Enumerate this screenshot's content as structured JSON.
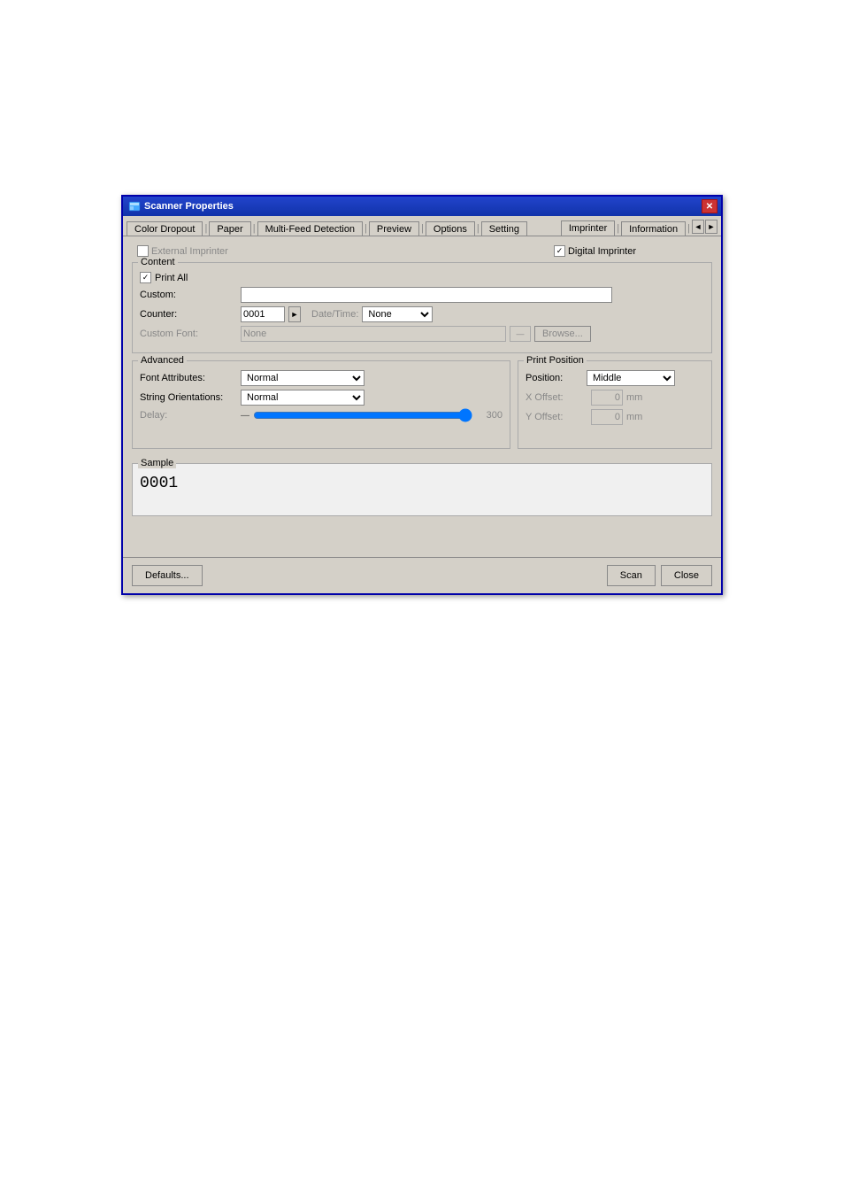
{
  "window": {
    "title": "Scanner Properties",
    "close_label": "✕"
  },
  "tabs": [
    {
      "label": "Color Dropout",
      "active": false
    },
    {
      "label": "Paper",
      "active": false
    },
    {
      "label": "Multi-Feed Detection",
      "active": false
    },
    {
      "label": "Preview",
      "active": false
    },
    {
      "label": "Options",
      "active": false
    },
    {
      "label": "Setting",
      "active": false
    },
    {
      "label": "Imprinter",
      "active": true
    },
    {
      "label": "Information",
      "active": false
    }
  ],
  "nav_arrows": {
    "left": "◄",
    "right": "►"
  },
  "imprinter": {
    "external_label": "External Imprinter",
    "external_checked": false,
    "digital_label": "Digital Imprinter",
    "digital_checked": true
  },
  "content_section": {
    "title": "Content",
    "print_all_label": "Print All",
    "print_all_checked": true,
    "custom_label": "Custom:",
    "custom_value": "",
    "counter_label": "Counter:",
    "counter_value": "0001",
    "counter_arrow": "►",
    "datetime_label": "Date/Time:",
    "datetime_value": "None",
    "datetime_options": [
      "None"
    ],
    "custom_font_label": "Custom Font:",
    "custom_font_value": "None",
    "font_btn_label": "—",
    "browse_label": "Browse..."
  },
  "advanced_section": {
    "title": "Advanced",
    "font_attr_label": "Font Attributes:",
    "font_attr_value": "Normal",
    "font_attr_options": [
      "Normal"
    ],
    "string_orient_label": "String Orientations:",
    "string_orient_value": "Normal",
    "string_orient_options": [
      "Normal"
    ],
    "delay_label": "Delay:",
    "delay_min": 0,
    "delay_max": 300,
    "delay_value": 300
  },
  "print_position_section": {
    "title": "Print Position",
    "position_label": "Position:",
    "position_value": "Middle",
    "position_options": [
      "Middle"
    ],
    "x_offset_label": "X Offset:",
    "x_offset_value": "0",
    "x_offset_unit": "mm",
    "y_offset_label": "Y Offset:",
    "y_offset_value": "0",
    "y_offset_unit": "mm"
  },
  "sample_section": {
    "title": "Sample",
    "value": "0001"
  },
  "footer": {
    "defaults_label": "Defaults...",
    "scan_label": "Scan",
    "close_label": "Close"
  }
}
